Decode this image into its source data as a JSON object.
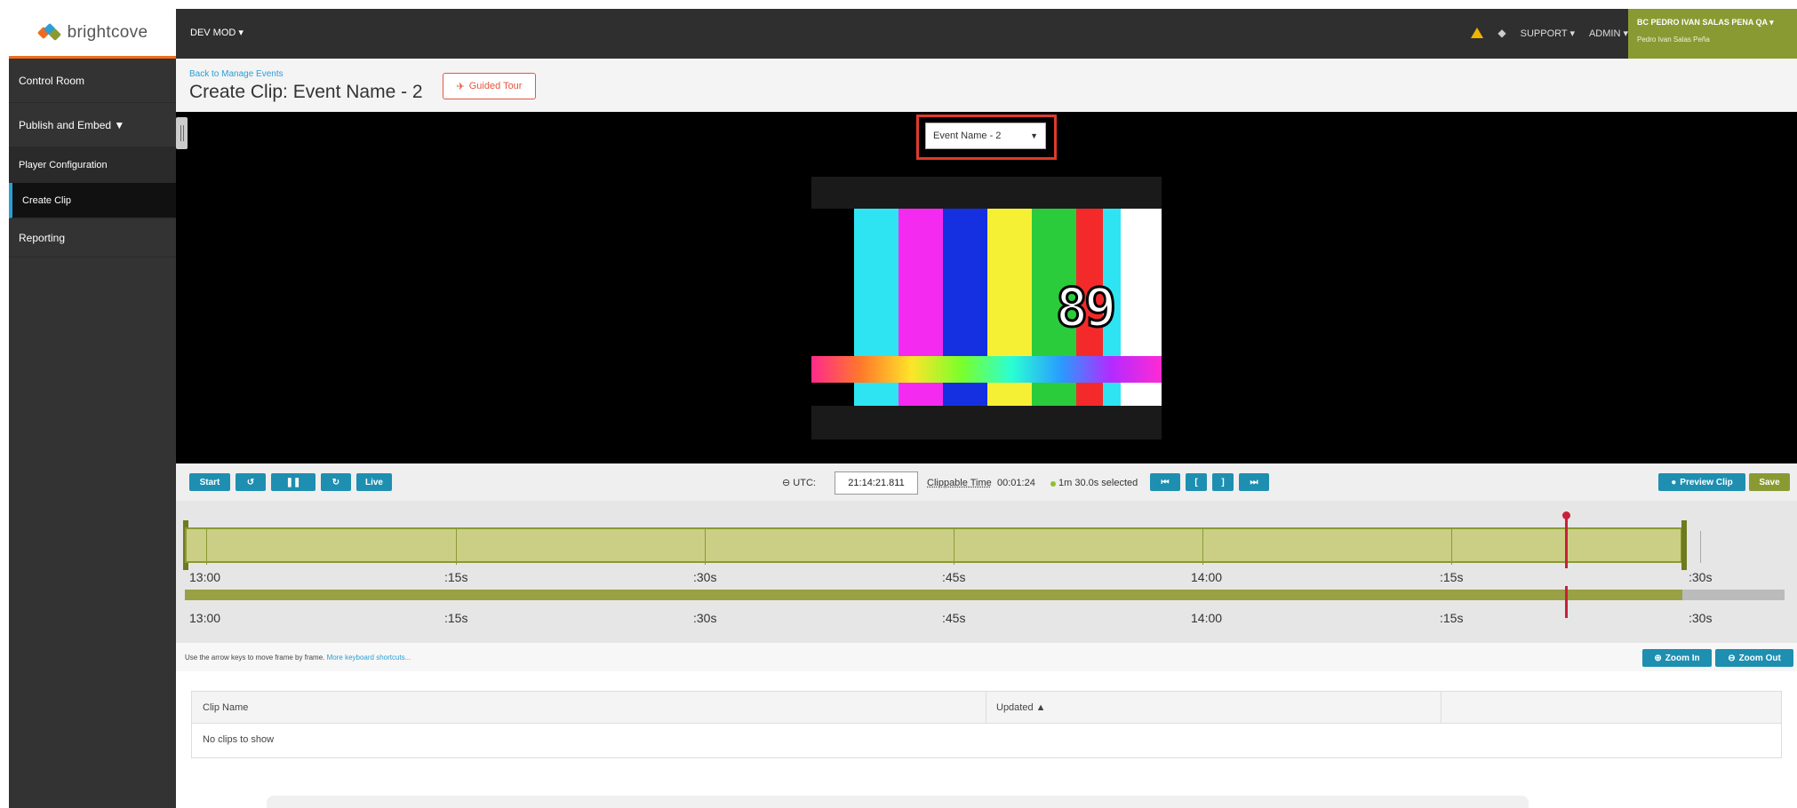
{
  "brand": {
    "logo_text": "brightcove",
    "accent": "#f26b1d"
  },
  "topbar": {
    "org": "DEV MOD ▾",
    "support": "SUPPORT ▾",
    "admin": "ADMIN ▾",
    "account_name": "BC PEDRO IVAN SALAS PENA QA ▾",
    "account_user": "Pedro Ivan Salas Peña"
  },
  "sidebar": {
    "items": [
      {
        "label": "Control Room"
      },
      {
        "label": "Publish and Embed ▼"
      },
      {
        "label": "Player Configuration"
      },
      {
        "label": "Create Clip"
      },
      {
        "label": "Reporting"
      }
    ]
  },
  "header": {
    "back_link": "Back to Manage Events",
    "title": "Create Clip: Event Name - 2",
    "guided_tour": "Guided Tour"
  },
  "video": {
    "event_select": "Event Name - 2",
    "countdown": "89"
  },
  "controls": {
    "start": "Start",
    "rewind": "↺",
    "pause": "❚❚",
    "forward": "↻",
    "live": "Live",
    "utc_label": "UTC:",
    "utc_value": "21:14:21.811",
    "clippable_label": "Clippable Time",
    "clippable_value": "00:01:24",
    "selected_text": "1m 30.0s selected",
    "preview": "Preview Clip",
    "save": "Save"
  },
  "timeline": {
    "labels": [
      "13:00",
      ":15s",
      ":30s",
      ":45s",
      "14:00",
      ":15s",
      ":30s"
    ]
  },
  "hint": {
    "text": "Use the arrow keys to move frame by frame.",
    "link": "More keyboard shortcuts..."
  },
  "zoom": {
    "in": "Zoom In",
    "out": "Zoom Out"
  },
  "table": {
    "columns": [
      "Clip Name",
      "Updated ▲"
    ],
    "empty": "No clips to show"
  }
}
